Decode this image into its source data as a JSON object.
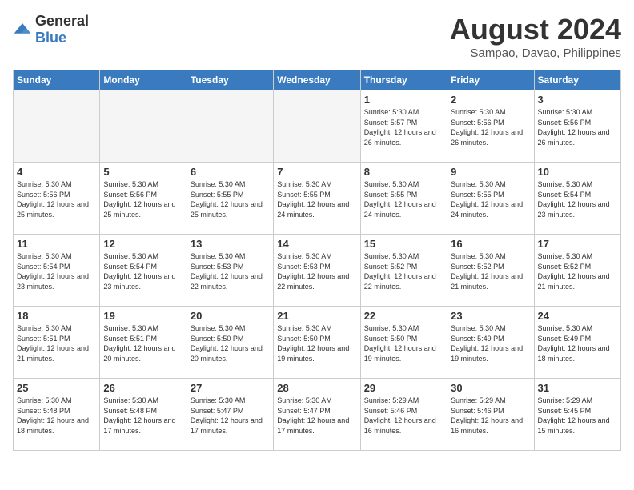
{
  "header": {
    "logo_general": "General",
    "logo_blue": "Blue",
    "month_year": "August 2024",
    "location": "Sampao, Davao, Philippines"
  },
  "days_of_week": [
    "Sunday",
    "Monday",
    "Tuesday",
    "Wednesday",
    "Thursday",
    "Friday",
    "Saturday"
  ],
  "weeks": [
    [
      {
        "day": "",
        "empty": true
      },
      {
        "day": "",
        "empty": true
      },
      {
        "day": "",
        "empty": true
      },
      {
        "day": "",
        "empty": true
      },
      {
        "day": "1",
        "sunrise": "5:30 AM",
        "sunset": "5:57 PM",
        "daylight": "12 hours and 26 minutes."
      },
      {
        "day": "2",
        "sunrise": "5:30 AM",
        "sunset": "5:56 PM",
        "daylight": "12 hours and 26 minutes."
      },
      {
        "day": "3",
        "sunrise": "5:30 AM",
        "sunset": "5:56 PM",
        "daylight": "12 hours and 26 minutes."
      }
    ],
    [
      {
        "day": "4",
        "sunrise": "5:30 AM",
        "sunset": "5:56 PM",
        "daylight": "12 hours and 25 minutes."
      },
      {
        "day": "5",
        "sunrise": "5:30 AM",
        "sunset": "5:56 PM",
        "daylight": "12 hours and 25 minutes."
      },
      {
        "day": "6",
        "sunrise": "5:30 AM",
        "sunset": "5:55 PM",
        "daylight": "12 hours and 25 minutes."
      },
      {
        "day": "7",
        "sunrise": "5:30 AM",
        "sunset": "5:55 PM",
        "daylight": "12 hours and 24 minutes."
      },
      {
        "day": "8",
        "sunrise": "5:30 AM",
        "sunset": "5:55 PM",
        "daylight": "12 hours and 24 minutes."
      },
      {
        "day": "9",
        "sunrise": "5:30 AM",
        "sunset": "5:55 PM",
        "daylight": "12 hours and 24 minutes."
      },
      {
        "day": "10",
        "sunrise": "5:30 AM",
        "sunset": "5:54 PM",
        "daylight": "12 hours and 23 minutes."
      }
    ],
    [
      {
        "day": "11",
        "sunrise": "5:30 AM",
        "sunset": "5:54 PM",
        "daylight": "12 hours and 23 minutes."
      },
      {
        "day": "12",
        "sunrise": "5:30 AM",
        "sunset": "5:54 PM",
        "daylight": "12 hours and 23 minutes."
      },
      {
        "day": "13",
        "sunrise": "5:30 AM",
        "sunset": "5:53 PM",
        "daylight": "12 hours and 22 minutes."
      },
      {
        "day": "14",
        "sunrise": "5:30 AM",
        "sunset": "5:53 PM",
        "daylight": "12 hours and 22 minutes."
      },
      {
        "day": "15",
        "sunrise": "5:30 AM",
        "sunset": "5:52 PM",
        "daylight": "12 hours and 22 minutes."
      },
      {
        "day": "16",
        "sunrise": "5:30 AM",
        "sunset": "5:52 PM",
        "daylight": "12 hours and 21 minutes."
      },
      {
        "day": "17",
        "sunrise": "5:30 AM",
        "sunset": "5:52 PM",
        "daylight": "12 hours and 21 minutes."
      }
    ],
    [
      {
        "day": "18",
        "sunrise": "5:30 AM",
        "sunset": "5:51 PM",
        "daylight": "12 hours and 21 minutes."
      },
      {
        "day": "19",
        "sunrise": "5:30 AM",
        "sunset": "5:51 PM",
        "daylight": "12 hours and 20 minutes."
      },
      {
        "day": "20",
        "sunrise": "5:30 AM",
        "sunset": "5:50 PM",
        "daylight": "12 hours and 20 minutes."
      },
      {
        "day": "21",
        "sunrise": "5:30 AM",
        "sunset": "5:50 PM",
        "daylight": "12 hours and 19 minutes."
      },
      {
        "day": "22",
        "sunrise": "5:30 AM",
        "sunset": "5:50 PM",
        "daylight": "12 hours and 19 minutes."
      },
      {
        "day": "23",
        "sunrise": "5:30 AM",
        "sunset": "5:49 PM",
        "daylight": "12 hours and 19 minutes."
      },
      {
        "day": "24",
        "sunrise": "5:30 AM",
        "sunset": "5:49 PM",
        "daylight": "12 hours and 18 minutes."
      }
    ],
    [
      {
        "day": "25",
        "sunrise": "5:30 AM",
        "sunset": "5:48 PM",
        "daylight": "12 hours and 18 minutes."
      },
      {
        "day": "26",
        "sunrise": "5:30 AM",
        "sunset": "5:48 PM",
        "daylight": "12 hours and 17 minutes."
      },
      {
        "day": "27",
        "sunrise": "5:30 AM",
        "sunset": "5:47 PM",
        "daylight": "12 hours and 17 minutes."
      },
      {
        "day": "28",
        "sunrise": "5:30 AM",
        "sunset": "5:47 PM",
        "daylight": "12 hours and 17 minutes."
      },
      {
        "day": "29",
        "sunrise": "5:29 AM",
        "sunset": "5:46 PM",
        "daylight": "12 hours and 16 minutes."
      },
      {
        "day": "30",
        "sunrise": "5:29 AM",
        "sunset": "5:46 PM",
        "daylight": "12 hours and 16 minutes."
      },
      {
        "day": "31",
        "sunrise": "5:29 AM",
        "sunset": "5:45 PM",
        "daylight": "12 hours and 15 minutes."
      }
    ]
  ],
  "labels": {
    "sunrise_prefix": "Sunrise:",
    "sunset_prefix": "Sunset:",
    "daylight_prefix": "Daylight: 12 hours"
  }
}
